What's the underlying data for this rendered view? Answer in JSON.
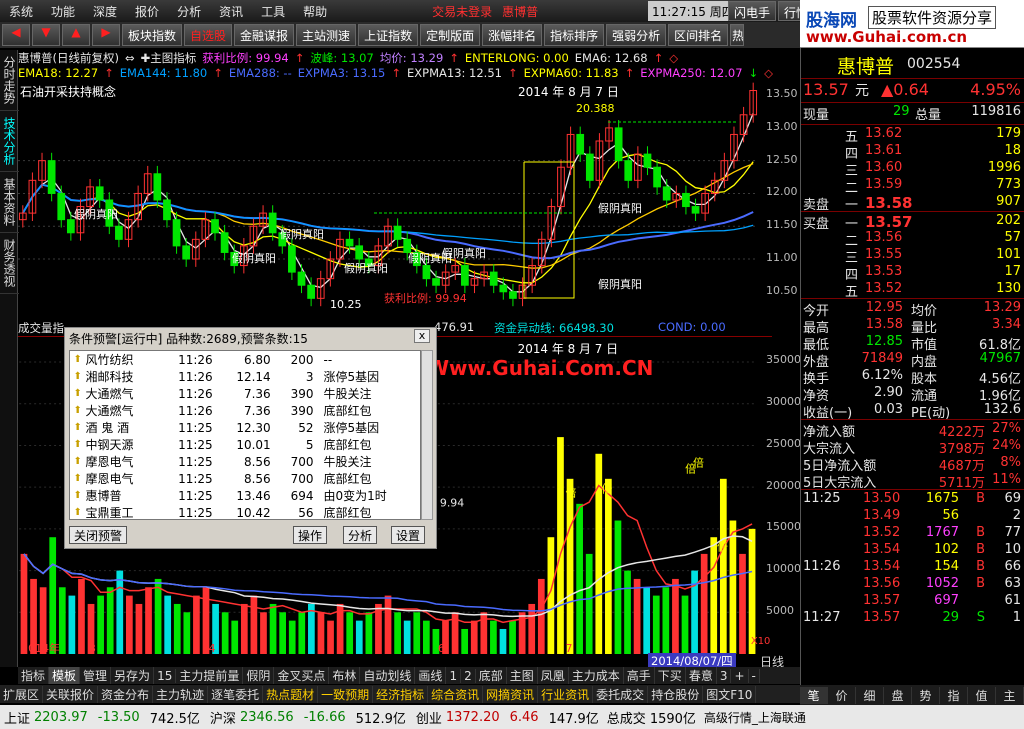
{
  "menubar": {
    "items": [
      "系统",
      "功能",
      "深度",
      "报价",
      "分析",
      "资讯",
      "工具",
      "帮助"
    ],
    "status": "交易未登录",
    "user": "惠博普",
    "clock": "11:27:15 周四",
    "extra1": "闪电手",
    "extra2": "行情"
  },
  "toolbar": {
    "buttons": [
      "板块指数",
      "自选股",
      "金融谋报",
      "主站测速",
      "上证指数",
      "定制版面",
      "涨幅排名",
      "指标排序",
      "强弱分析",
      "区间排名",
      "热"
    ],
    "red_index": 1,
    "arrows": [
      "◀",
      "▼",
      "▲",
      "▶"
    ]
  },
  "logo": {
    "name": "股海网",
    "slogan": "股票软件资源分享",
    "url": "www.Guhai.com.cn"
  },
  "left_tabs": [
    "分时走势",
    "技术分析",
    "基本资料",
    "财务透视"
  ],
  "indicators": {
    "line1": [
      {
        "t": "惠博普(日线前复权)",
        "c": "#e6e6e6"
      },
      {
        "t": "⇔",
        "c": "#e6e6e6"
      },
      {
        "t": "✚主图指标",
        "c": "#e6e6e6"
      },
      {
        "t": "获利比例: 99.94",
        "c": "#ff40ff"
      },
      {
        "t": "↑",
        "c": "#ff3232"
      },
      {
        "t": "波峰: 13.07",
        "c": "#00e600"
      },
      {
        "t": "均价: 13.29",
        "c": "#c080ff"
      },
      {
        "t": "↑",
        "c": "#ff3232"
      },
      {
        "t": "ENTERLONG: 0.00",
        "c": "#ffff00"
      },
      {
        "t": "EMA6: 12.68",
        "c": "#e6e6e6"
      },
      {
        "t": "↑",
        "c": "#ff3232"
      },
      {
        "t": "◇",
        "c": "#ff3232"
      }
    ],
    "line2": [
      {
        "t": "EMA18: 12.27",
        "c": "#ffff00"
      },
      {
        "t": "↑",
        "c": "#ff3232"
      },
      {
        "t": "EMA144: 11.80",
        "c": "#00a0ff"
      },
      {
        "t": "↑",
        "c": "#ff3232"
      },
      {
        "t": "EMA288: --",
        "c": "#4a6bff"
      },
      {
        "t": "EXPMA3: 13.15",
        "c": "#4a6bff"
      },
      {
        "t": "↑",
        "c": "#ff3232"
      },
      {
        "t": "EXPMA13: 12.51",
        "c": "#e6e6e6"
      },
      {
        "t": "↑",
        "c": "#ff3232"
      },
      {
        "t": "EXPMA60: 11.83",
        "c": "#ffff00"
      },
      {
        "t": "↑",
        "c": "#ff3232"
      },
      {
        "t": "EXPMA250: 12.07",
        "c": "#ff40ff"
      },
      {
        "t": "↓",
        "c": "#00e600"
      },
      {
        "t": "◇",
        "c": "#ff3232"
      }
    ]
  },
  "main_chart": {
    "overlay_label": "石油开采扶持概念",
    "date_label": "2014 年 8 月 7 日",
    "high_label": "20.388",
    "low_label": "10.25",
    "profit_label": "获利比例: 99.94",
    "pattern_labels": [
      "假阴真阳",
      "假阴真阳",
      "假阴真阳",
      "假阴真阳",
      "假阴真阳",
      "假阴真阳",
      "假阴真阳",
      "假阴真阳"
    ],
    "y_ticks": [
      "13.50",
      "13.00",
      "12.50",
      "12.00",
      "11.50",
      "11.00",
      "10.50"
    ]
  },
  "volume_chart": {
    "header_left": "成交量指",
    "header_mid": "476.91",
    "header_mid2": "资金异动线: 66498.30",
    "header_right": "COND: 0.00",
    "mid_value": "9.94",
    "date_label": "2014 年 8 月 7 日",
    "y_ticks": [
      "35000",
      "30000",
      "25000",
      "20000",
      "15000",
      "10000",
      "5000"
    ],
    "unit": "X10",
    "bei": "倍"
  },
  "popup": {
    "title": "条件预警[运行中] 品种数:2689,预警条数:15",
    "close": "x",
    "rows": [
      [
        "风竹纺织",
        "11:26",
        "6.80",
        "200",
        "--"
      ],
      [
        "湘邮科技",
        "11:26",
        "12.14",
        "3",
        "涨停5基因"
      ],
      [
        "大通燃气",
        "11:26",
        "7.36",
        "390",
        "牛股关注"
      ],
      [
        "大通燃气",
        "11:26",
        "7.36",
        "390",
        "底部红包"
      ],
      [
        "酒 鬼 酒",
        "11:25",
        "12.30",
        "52",
        "涨停5基因"
      ],
      [
        "中钢天源",
        "11:25",
        "10.01",
        "5",
        "底部红包"
      ],
      [
        "摩恩电气",
        "11:25",
        "8.56",
        "700",
        "牛股关注"
      ],
      [
        "摩恩电气",
        "11:25",
        "8.56",
        "700",
        "底部红包"
      ],
      [
        "惠博普",
        "11:25",
        "13.46",
        "694",
        "由0变为1时"
      ],
      [
        "宝鼎重工",
        "11:25",
        "10.42",
        "56",
        "底部红包"
      ]
    ],
    "buttons": [
      "关闭预警",
      "操作",
      "分析",
      "设置"
    ]
  },
  "watermark": "股海网提供 Www.Guhai.Com.CN",
  "bottom_tabs": [
    "指标",
    "模板",
    "管理",
    "另存为",
    "15",
    "主力提前量",
    "假阴",
    "金叉买点",
    "布林",
    "自动划线",
    "画线",
    "1",
    "2",
    "底部",
    "主图",
    "凤凰",
    "主力成本",
    "高手",
    "下买",
    "春意",
    "3",
    "+",
    "-"
  ],
  "bottom_active": 1,
  "x_labels": [
    "2014年",
    "3",
    "4",
    "5",
    "6",
    "7"
  ],
  "date_box": "2014/08/07/四",
  "line_type": "日线",
  "fnbar": [
    "扩展区",
    "关联报价",
    "资金分布",
    "主力轨迹",
    "逐笔委托",
    "热点题材",
    "一致预期",
    "经济指标",
    "综合资讯",
    "网摘资讯",
    "行业资讯",
    "委托成交",
    "持仓股份",
    "图文F10"
  ],
  "fnbar_yellow": [
    5,
    6,
    7,
    8,
    9,
    10
  ],
  "right_panel": {
    "name": "惠博普",
    "code": "002554",
    "price": "13.57",
    "unit": "元",
    "change": "▲0.64",
    "pct": "4.95%",
    "now_label": "现量",
    "now_val": "29",
    "total_label": "总量",
    "total_val": "119816",
    "asks": [
      [
        "五",
        "13.62",
        "179"
      ],
      [
        "四",
        "13.61",
        "18"
      ],
      [
        "三",
        "13.60",
        "1996"
      ],
      [
        "二",
        "13.59",
        "773"
      ],
      [
        "一",
        "13.58",
        "907"
      ]
    ],
    "sell_label": "卖盘",
    "buy_label": "买盘",
    "bids": [
      [
        "一",
        "13.57",
        "202"
      ],
      [
        "二",
        "13.56",
        "57"
      ],
      [
        "三",
        "13.55",
        "101"
      ],
      [
        "四",
        "13.53",
        "17"
      ],
      [
        "五",
        "13.52",
        "130"
      ]
    ],
    "stats": [
      [
        "今开",
        "12.95",
        "均价",
        "13.29"
      ],
      [
        "最高",
        "13.58",
        "量比",
        "3.34"
      ],
      [
        "最低",
        "12.85",
        "市值",
        "61.8亿"
      ],
      [
        "外盘",
        "71849",
        "内盘",
        "47967"
      ],
      [
        "换手",
        "6.12%",
        "股本",
        "4.56亿"
      ],
      [
        "净资",
        "2.90",
        "流通",
        "1.96亿"
      ],
      [
        "收益(一)",
        "0.03",
        "PE(动)",
        "132.6"
      ]
    ],
    "flows": [
      [
        "净流入额",
        "4222万",
        "27%"
      ],
      [
        "大宗流入",
        "3798万",
        "24%"
      ],
      [
        "5日净流入额",
        "4687万",
        "8%"
      ],
      [
        "5日大宗流入",
        "5711万",
        "11%"
      ]
    ],
    "ticks": [
      [
        "11:25",
        "13.50",
        "1675",
        "B",
        "69"
      ],
      [
        "",
        "13.49",
        "56",
        "",
        "2"
      ],
      [
        "",
        "13.52",
        "1767",
        "B",
        "77"
      ],
      [
        "",
        "13.54",
        "102",
        "B",
        "10"
      ],
      [
        "11:26",
        "13.54",
        "154",
        "B",
        "66"
      ],
      [
        "",
        "13.56",
        "1052",
        "B",
        "63"
      ],
      [
        "",
        "13.57",
        "697",
        "",
        "61"
      ],
      [
        "11:27",
        "13.57",
        "29",
        "S",
        "1"
      ]
    ]
  },
  "right_tabs": [
    "笔",
    "价",
    "细",
    "盘",
    "势",
    "指",
    "值",
    "主"
  ],
  "index_bar": {
    "sh_label": "上证",
    "sh_val": "2203.97",
    "sh_chg": "-13.50",
    "sh_amt": "742.5亿",
    "hs_label": "沪深",
    "hs_val": "2346.56",
    "hs_chg": "-16.66",
    "hs_amt": "512.9亿",
    "cy_label": "创业",
    "cy_val": "1372.20",
    "cy_chg": "6.46",
    "cy_amt": "147.9亿",
    "total_label": "总成交",
    "total_val": "1590亿",
    "feed": "高级行情_上海联通"
  },
  "chart_data": {
    "type": "candlestick",
    "note_colors": {
      "up": "#ff3232",
      "down": "#00e600"
    },
    "closes": [
      11.7,
      12.2,
      12.5,
      12.0,
      11.6,
      11.4,
      11.8,
      12.1,
      11.9,
      11.5,
      11.3,
      11.6,
      12.0,
      12.3,
      11.9,
      11.6,
      11.2,
      11.0,
      11.3,
      11.6,
      11.4,
      11.1,
      10.9,
      11.2,
      11.5,
      11.7,
      11.4,
      11.2,
      10.8,
      10.6,
      10.4,
      10.7,
      11.0,
      11.3,
      11.2,
      11.0,
      10.9,
      11.2,
      11.5,
      11.3,
      11.1,
      10.9,
      10.7,
      10.6,
      10.8,
      10.9,
      10.6,
      10.7,
      10.8,
      10.6,
      10.5,
      10.4,
      10.6,
      10.9,
      11.3,
      11.8,
      12.4,
      12.9,
      12.6,
      12.2,
      12.8,
      13.0,
      12.5,
      12.2,
      12.6,
      12.4,
      12.1,
      11.9,
      12.0,
      11.8,
      11.7,
      12.0,
      12.2,
      12.5,
      12.9,
      13.2,
      13.57
    ],
    "volumes": [
      12000,
      9000,
      8000,
      14000,
      8000,
      7000,
      9000,
      6000,
      7000,
      8000,
      10000,
      7000,
      6000,
      8000,
      9000,
      7000,
      6000,
      5000,
      7000,
      8000,
      6000,
      5000,
      4000,
      6000,
      7000,
      5000,
      6000,
      5000,
      4000,
      5000,
      6000,
      5000,
      4000,
      6000,
      5000,
      4000,
      5000,
      6000,
      7000,
      5000,
      4000,
      5000,
      4000,
      3000,
      4000,
      5000,
      3000,
      4000,
      5000,
      4000,
      3000,
      4000,
      5000,
      6000,
      9000,
      14000,
      26000,
      21000,
      18000,
      12000,
      24000,
      21000,
      16000,
      10000,
      9000,
      8000,
      7000,
      8000,
      9000,
      7000,
      10000,
      12000,
      14000,
      21000,
      16000,
      12000,
      15000
    ]
  }
}
